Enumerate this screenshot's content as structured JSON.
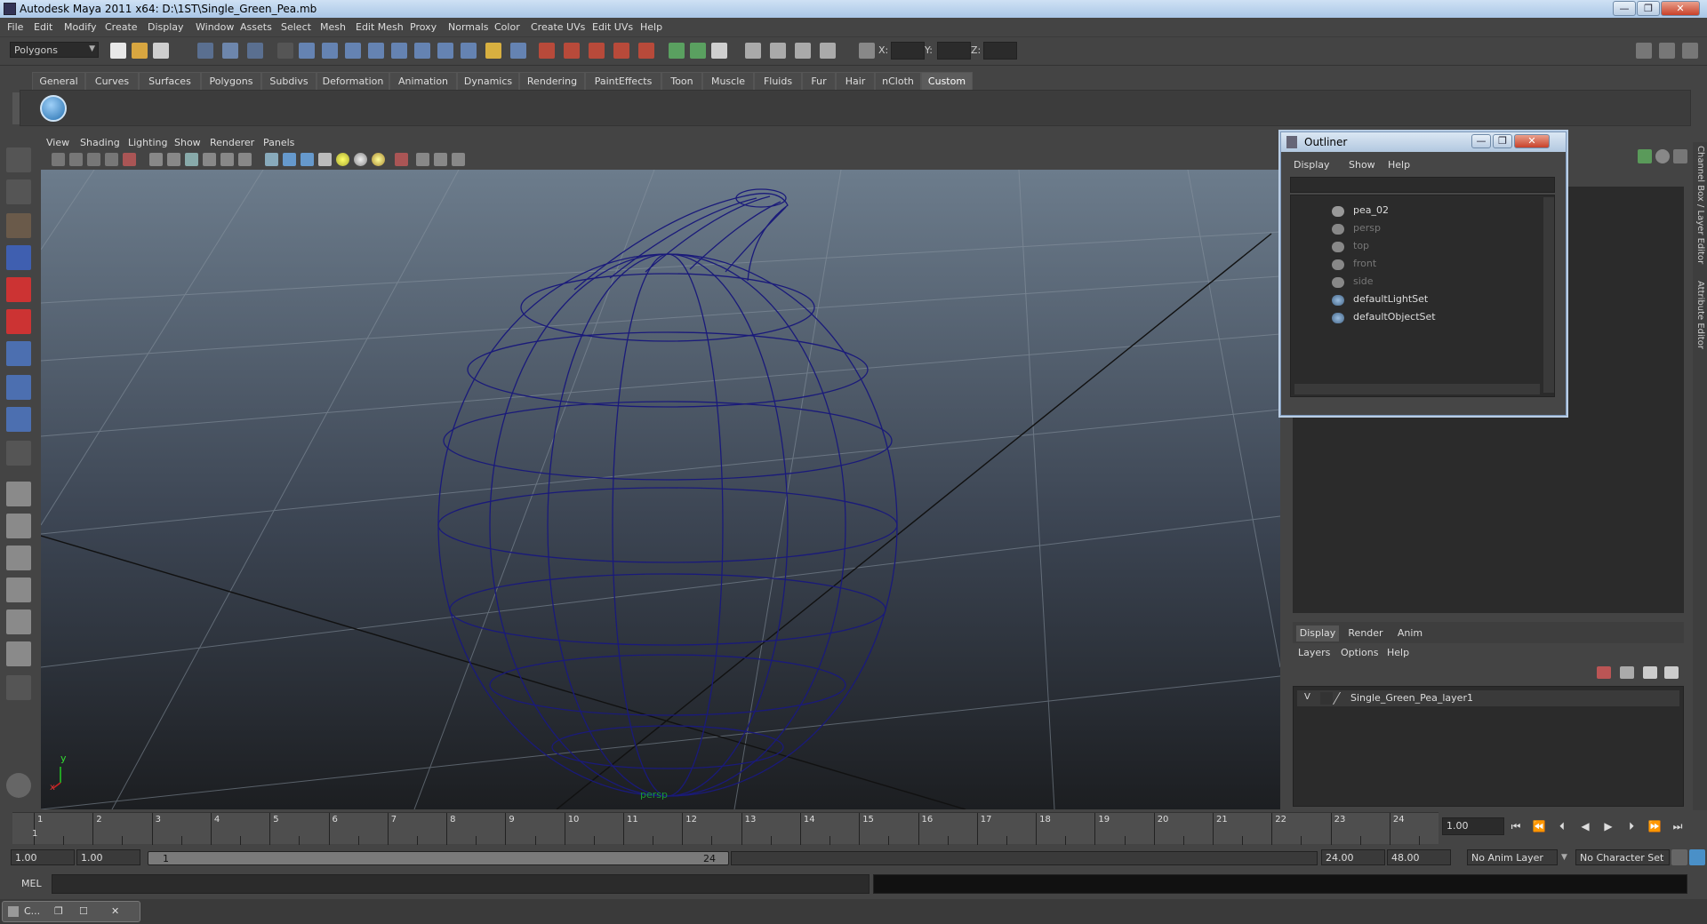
{
  "window": {
    "title": "Autodesk Maya 2011 x64: D:\\1ST\\Single_Green_Pea.mb",
    "minimize": "—",
    "maximize": "❐",
    "close": "✕"
  },
  "menubar": [
    "File",
    "Edit",
    "Modify",
    "Create",
    "Display",
    "Window",
    "Assets",
    "Select",
    "Mesh",
    "Edit Mesh",
    "Proxy",
    "Normals",
    "Color",
    "Create UVs",
    "Edit UVs",
    "Help"
  ],
  "toolbar": {
    "mode_select": "Polygons",
    "x_label": "X:",
    "y_label": "Y:",
    "z_label": "Z:"
  },
  "shelf_tabs": [
    "General",
    "Curves",
    "Surfaces",
    "Polygons",
    "Subdivs",
    "Deformation",
    "Animation",
    "Dynamics",
    "Rendering",
    "PaintEffects",
    "Toon",
    "Muscle",
    "Fluids",
    "Fur",
    "Hair",
    "nCloth",
    "Custom"
  ],
  "shelf_active": "Custom",
  "viewport": {
    "menu": [
      "View",
      "Shading",
      "Lighting",
      "Show",
      "Renderer",
      "Panels"
    ],
    "camera_label": "persp",
    "axis_y": "y",
    "axis_x": "x",
    "wire_color": "#1a1a7a"
  },
  "outliner": {
    "title": "Outliner",
    "menu": [
      "Display",
      "Show",
      "Help"
    ],
    "items": [
      {
        "label": "pea_02",
        "dim": false,
        "icon": "mesh-icon"
      },
      {
        "label": "persp",
        "dim": true,
        "icon": "camera-icon"
      },
      {
        "label": "top",
        "dim": true,
        "icon": "camera-icon"
      },
      {
        "label": "front",
        "dim": true,
        "icon": "camera-icon"
      },
      {
        "label": "side",
        "dim": true,
        "icon": "camera-icon"
      },
      {
        "label": "defaultLightSet",
        "dim": false,
        "icon": "set-icon"
      },
      {
        "label": "defaultObjectSet",
        "dim": false,
        "icon": "set-icon"
      }
    ]
  },
  "side_tabs": {
    "channel_box": "Channel Box / Layer Editor",
    "attribute_editor": "Attribute Editor"
  },
  "layer_editor": {
    "tabs": [
      "Display",
      "Render",
      "Anim"
    ],
    "active_tab": "Display",
    "menu": [
      "Layers",
      "Options",
      "Help"
    ],
    "layer_visibility": "V",
    "layer_name": "Single_Green_Pea_layer1"
  },
  "timeline": {
    "ticks": [
      "1",
      "2",
      "3",
      "4",
      "5",
      "6",
      "7",
      "8",
      "9",
      "10",
      "11",
      "12",
      "13",
      "14",
      "15",
      "16",
      "17",
      "18",
      "19",
      "20",
      "21",
      "22",
      "23",
      "24"
    ],
    "current_marker": "1",
    "current_frame": "1.00"
  },
  "range": {
    "start_time": "1.00",
    "playback_start": "1.00",
    "slider_start": "1",
    "slider_end": "24",
    "playback_end": "24.00",
    "end_time": "48.00",
    "anim_layer": "No Anim Layer",
    "character_set": "No Character Set"
  },
  "mel": {
    "label": "MEL"
  },
  "taskbar": {
    "label": "C..."
  }
}
